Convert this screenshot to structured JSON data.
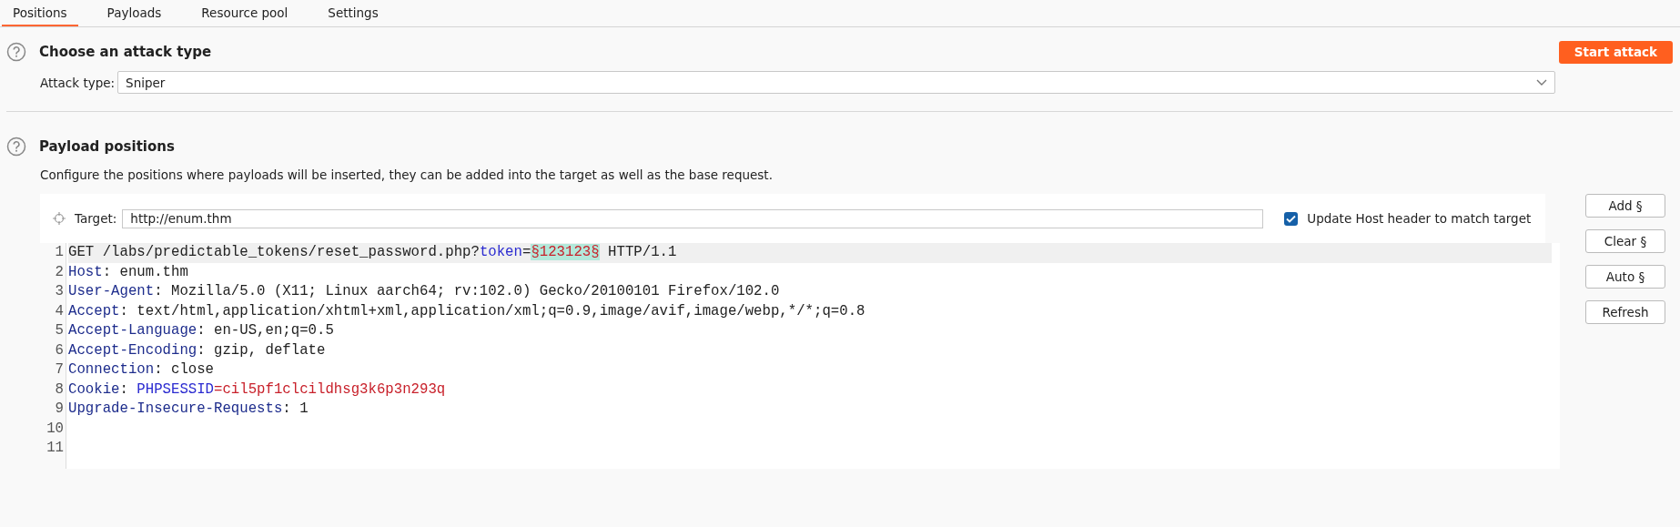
{
  "tabs": [
    {
      "label": "Positions",
      "selected": true
    },
    {
      "label": "Payloads",
      "selected": false
    },
    {
      "label": "Resource pool",
      "selected": false
    },
    {
      "label": "Settings",
      "selected": false
    }
  ],
  "attack_section": {
    "title": "Choose an attack type",
    "start_button": "Start attack",
    "attack_type_label": "Attack type:",
    "attack_type_value": "Sniper"
  },
  "positions_section": {
    "title": "Payload positions",
    "description": "Configure the positions where payloads will be inserted, they can be added into the target as well as the base request.",
    "target_label": "Target:",
    "target_value": "http://enum.thm",
    "update_host": {
      "label": "Update Host header to match target",
      "checked": true
    },
    "buttons": [
      "Add §",
      "Clear §",
      "Auto §",
      "Refresh"
    ],
    "request_lines": [
      {
        "number": "1",
        "selected": true,
        "segments": [
          {
            "text": "GET /labs/predictable_tokens/reset_password.php?",
            "kind": "plain"
          },
          {
            "text": "token",
            "kind": "param"
          },
          {
            "text": "=",
            "kind": "plain"
          },
          {
            "text": "§123123§",
            "kind": "payload"
          },
          {
            "text": " HTTP/1.1",
            "kind": "plain"
          }
        ]
      },
      {
        "number": "2",
        "selected": false,
        "segments": [
          {
            "text": "Host",
            "kind": "header"
          },
          {
            "text": ": enum.thm",
            "kind": "plain"
          }
        ]
      },
      {
        "number": "3",
        "selected": false,
        "segments": [
          {
            "text": "User-Agent",
            "kind": "header"
          },
          {
            "text": ": Mozilla/5.0 (X11; Linux aarch64; rv:102.0) Gecko/20100101 Firefox/102.0",
            "kind": "plain"
          }
        ]
      },
      {
        "number": "4",
        "selected": false,
        "segments": [
          {
            "text": "Accept",
            "kind": "header"
          },
          {
            "text": ": text/html,application/xhtml+xml,application/xml;q=0.9,image/avif,image/webp,*/*;q=0.8",
            "kind": "plain"
          }
        ]
      },
      {
        "number": "5",
        "selected": false,
        "segments": [
          {
            "text": "Accept-Language",
            "kind": "header"
          },
          {
            "text": ": en-US,en;q=0.5",
            "kind": "plain"
          }
        ]
      },
      {
        "number": "6",
        "selected": false,
        "segments": [
          {
            "text": "Accept-Encoding",
            "kind": "header"
          },
          {
            "text": ": gzip, deflate",
            "kind": "plain"
          }
        ]
      },
      {
        "number": "7",
        "selected": false,
        "segments": [
          {
            "text": "Connection",
            "kind": "header"
          },
          {
            "text": ": close",
            "kind": "plain"
          }
        ]
      },
      {
        "number": "8",
        "selected": false,
        "segments": [
          {
            "text": "Cookie",
            "kind": "header"
          },
          {
            "text": ": ",
            "kind": "plain"
          },
          {
            "text": "PHPSESSID",
            "kind": "param"
          },
          {
            "text": "=cil5pf1clcildhsg3k6p3n293q",
            "kind": "value"
          }
        ]
      },
      {
        "number": "9",
        "selected": false,
        "segments": [
          {
            "text": "Upgrade-Insecure-Requests",
            "kind": "header"
          },
          {
            "text": ": 1",
            "kind": "plain"
          }
        ]
      },
      {
        "number": "10",
        "selected": false
      },
      {
        "number": "11",
        "selected": false
      }
    ]
  }
}
